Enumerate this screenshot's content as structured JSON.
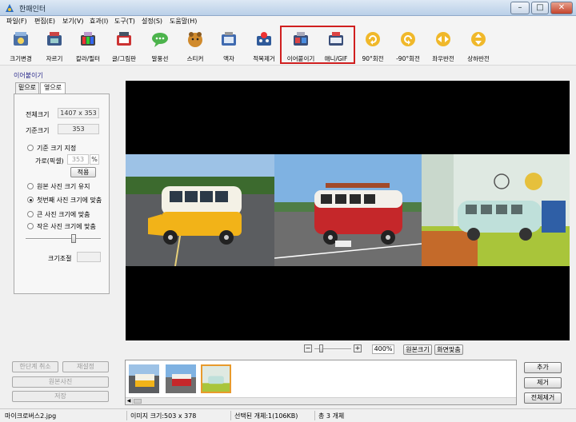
{
  "window": {
    "title": "한패인터"
  },
  "menu": [
    "파일(F)",
    "편집(E)",
    "보기(V)",
    "효과(I)",
    "도구(T)",
    "설정(S)",
    "도움말(H)"
  ],
  "toolbar": [
    {
      "label": "크기변경",
      "icon": "resize-icon"
    },
    {
      "label": "자르기",
      "icon": "crop-icon"
    },
    {
      "label": "칼라/필터",
      "icon": "color-filter-icon"
    },
    {
      "label": "글/그림판",
      "icon": "text-draw-icon"
    },
    {
      "label": "말풍선",
      "icon": "speech-bubble-icon"
    },
    {
      "label": "스티커",
      "icon": "sticker-icon"
    },
    {
      "label": "액자",
      "icon": "frame-icon"
    },
    {
      "label": "적목제거",
      "icon": "redeye-icon"
    },
    {
      "label": "이어붙이기",
      "icon": "merge-icon"
    },
    {
      "label": "애니/GIF",
      "icon": "gif-icon"
    },
    {
      "label": "90°회전",
      "icon": "rotate-cw-icon"
    },
    {
      "label": "-90°회전",
      "icon": "rotate-ccw-icon"
    },
    {
      "label": "좌우반전",
      "icon": "flip-horizontal-icon"
    },
    {
      "label": "상하반전",
      "icon": "flip-vertical-icon"
    }
  ],
  "panel": {
    "section_title": "이어붙이기",
    "tabs": [
      "밑으로",
      "옆으로"
    ],
    "total_size_label": "전체크기",
    "total_size_value": "1407 x 353",
    "base_size_label": "기준크기",
    "base_size_value": "353",
    "option_set_base": "기준 크기 지정",
    "width_px_label": "가로(픽셀)",
    "width_px_value": "353",
    "apply_button": "적용",
    "option_keep_original": "원본 사진 크기 유지",
    "option_fit_first": "첫번째 사진 크기에 맞춤",
    "option_fit_large": "큰 사진 크기에 맞춤",
    "option_fit_small": "작은 사진 크기에 맞춤",
    "size_adjust_label": "크기조절",
    "selected_option": "option_fit_first"
  },
  "left_buttons": {
    "undo": "한단계 취소",
    "reset": "재설정",
    "original": "원본사진",
    "save": "저장"
  },
  "zoom": {
    "value": "400%",
    "original_size": "원본크기",
    "fit_screen": "화면맞춤"
  },
  "right_buttons": {
    "add": "추가",
    "remove": "제거",
    "remove_all": "전체제거"
  },
  "status": {
    "filename": "마이크로버스2.jpg",
    "image_size": "이미지 크기:503 x 378",
    "selected": "선택된 개체:1(106KB)",
    "total": "총 3 개체"
  },
  "colors": {
    "highlight": "#d01f1f",
    "viewer_bg": "#000000",
    "thumb_selected": "#e89a2c"
  }
}
